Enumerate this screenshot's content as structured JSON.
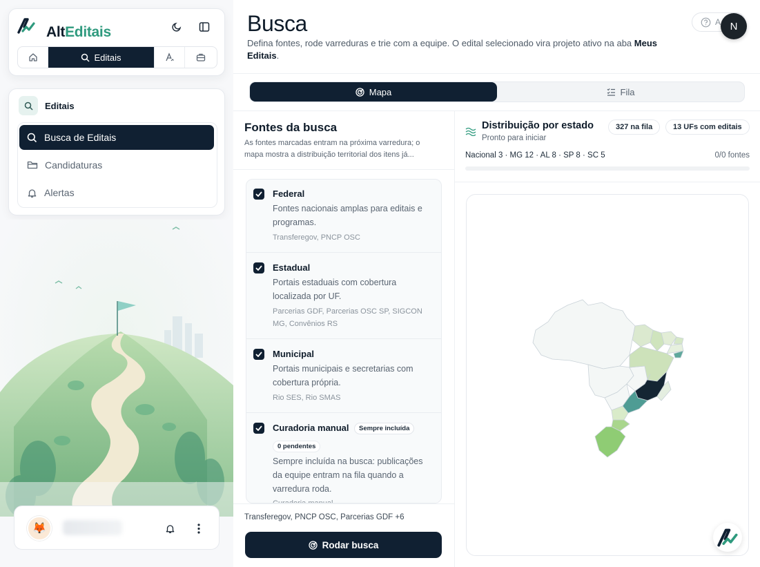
{
  "brand": {
    "name_part1": "Alt",
    "name_part2": "Editais"
  },
  "topnav": {
    "active_label": "Editais"
  },
  "nav": {
    "section_label": "Editais",
    "items": [
      {
        "label": "Busca de Editais",
        "icon": "search-icon",
        "active": true
      },
      {
        "label": "Candidaturas",
        "icon": "folder-icon",
        "active": false
      },
      {
        "label": "Alertas",
        "icon": "bell-icon",
        "active": false
      }
    ]
  },
  "header": {
    "title": "Busca",
    "subtitle_prefix": "Defina fontes, rode varreduras e trie com a equipe. O edital selecionado vira projeto ativo na aba ",
    "subtitle_link": "Meus Editais",
    "subtitle_suffix": ".",
    "help_label": "A",
    "user_initial": "N"
  },
  "tabs": [
    {
      "label": "Mapa",
      "icon": "target-icon",
      "active": true
    },
    {
      "label": "Fila",
      "icon": "checklist-icon",
      "active": false
    }
  ],
  "sources_panel": {
    "title": "Fontes da busca",
    "description": "As fontes marcadas entram na próxima varredura; o mapa mostra a distribuição territorial dos itens já...",
    "sources": [
      {
        "name": "Federal",
        "description": "Fontes nacionais amplas para editais e programas.",
        "tags": "Transferegov, PNCP OSC",
        "checked": true
      },
      {
        "name": "Estadual",
        "description": "Portais estaduais com cobertura localizada por UF.",
        "tags": "Parcerias GDF, Parcerias OSC SP, SIGCON MG, Convênios RS",
        "checked": true
      },
      {
        "name": "Municipal",
        "description": "Portais municipais e secretarias com cobertura própria.",
        "tags": "Rio SES, Rio SMAS",
        "checked": true
      },
      {
        "name": "Curadoria manual",
        "badge": "Sempre incluída",
        "pending_badge": "0 pendentes",
        "description": "Sempre incluída na busca: publicações da equipe entram na fila quando a varredura roda.",
        "tags": "Curadoria manual",
        "checked": true
      }
    ],
    "summary": "Transferegov, PNCP OSC, Parcerias GDF +6",
    "run_button": "Rodar busca"
  },
  "map_panel": {
    "title": "Distribuição por estado",
    "status": "Pronto para iniciar",
    "queue_pill": "327 na fila",
    "ufs_pill": "13 UFs com editais",
    "distribution": "Nacional 3 · MG 12 · AL 8 · SP 8 · SC 5",
    "sources_count": "0/0 fontes",
    "progress": 0
  },
  "colors": {
    "navy": "#102032",
    "accent": "#2f9a7e",
    "map_dark": "#142533",
    "map_teal": "#4f9c94",
    "map_green": "#8fcc74"
  }
}
